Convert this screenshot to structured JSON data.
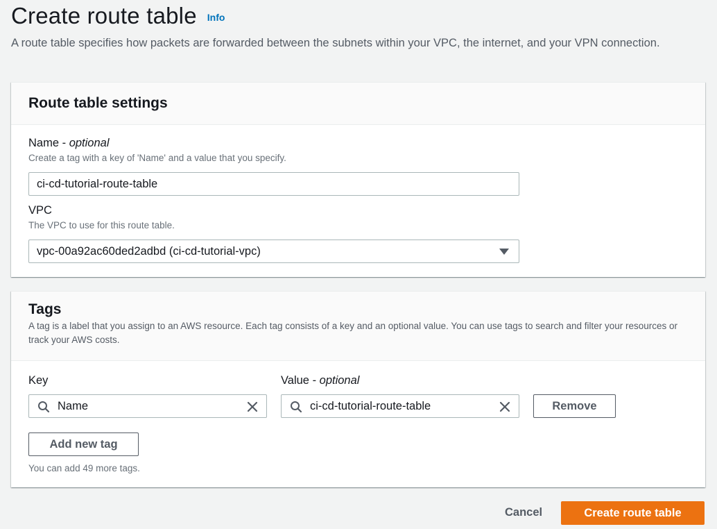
{
  "page": {
    "title": "Create route table",
    "info_link": "Info",
    "description": "A route table specifies how packets are forwarded between the subnets within your VPC, the internet, and your VPN connection."
  },
  "settings": {
    "title": "Route table settings",
    "name_label": "Name",
    "name_optional": "optional",
    "name_desc": "Create a tag with a key of 'Name' and a value that you specify.",
    "name_value": "ci-cd-tutorial-route-table",
    "vpc_label": "VPC",
    "vpc_desc": "The VPC to use for this route table.",
    "vpc_selected": "vpc-00a92ac60ded2adbd (ci-cd-tutorial-vpc)"
  },
  "tags": {
    "title": "Tags",
    "description": "A tag is a label that you assign to an AWS resource. Each tag consists of a key and an optional value. You can use tags to search and filter your resources or track your AWS costs.",
    "key_label": "Key",
    "value_label": "Value",
    "value_optional": "optional",
    "rows": [
      {
        "key": "Name",
        "value": "ci-cd-tutorial-route-table",
        "remove_label": "Remove"
      }
    ],
    "add_label": "Add new tag",
    "remaining_hint": "You can add 49 more tags."
  },
  "footer": {
    "cancel_label": "Cancel",
    "submit_label": "Create route table"
  },
  "colors": {
    "primary": "#ec7211",
    "link": "#0073bb",
    "background": "#f2f3f3"
  }
}
